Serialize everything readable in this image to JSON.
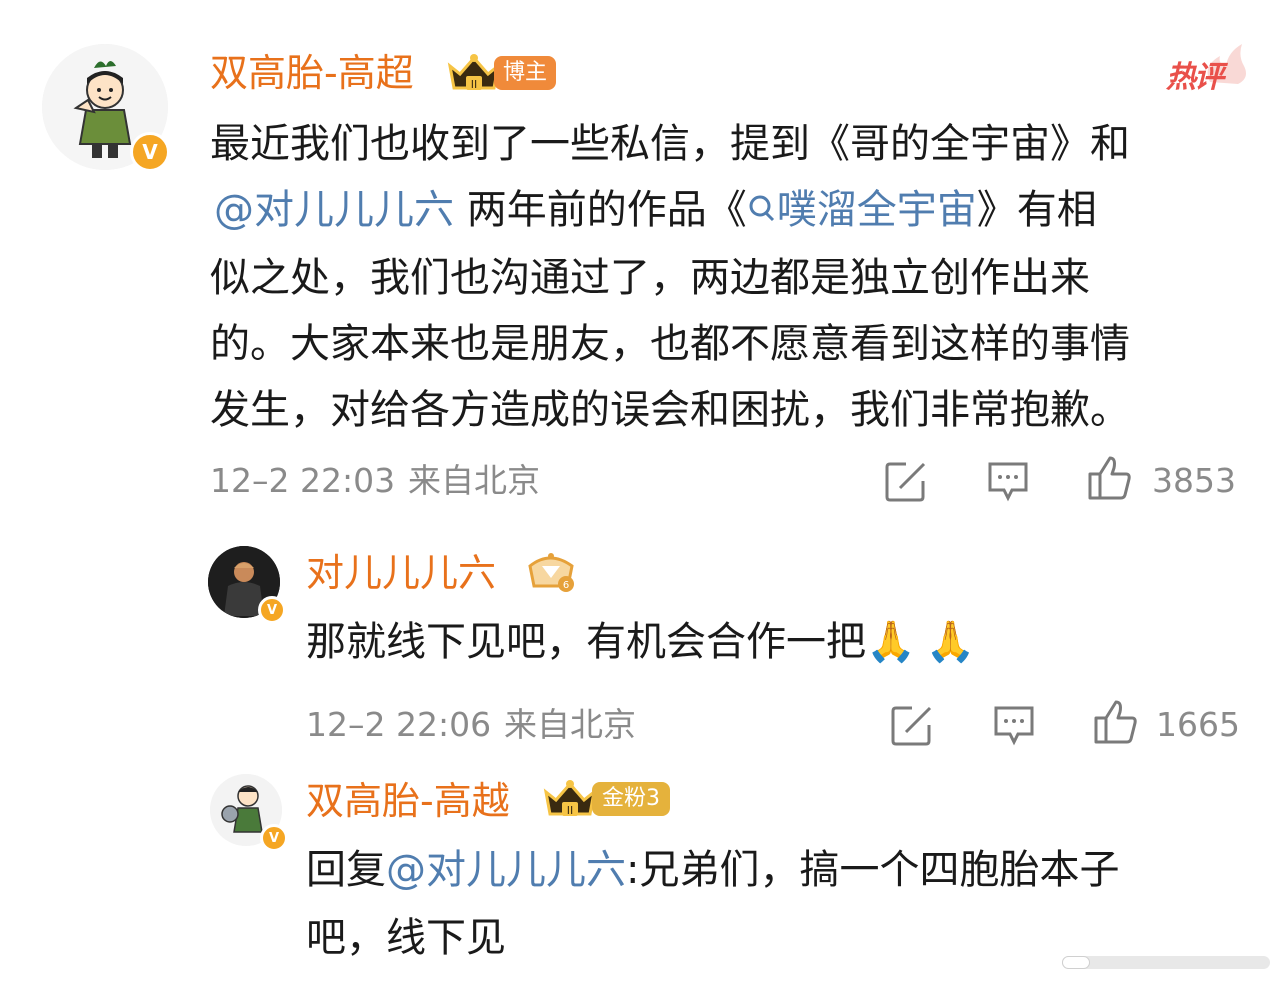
{
  "hot_tag": "热评",
  "comment": {
    "username": "双高胎-高超",
    "badge": "博主",
    "verified": "V",
    "lines": {
      "l1": "最近我们也收到了一些私信，提到《哥的全宇宙》和",
      "l2_mention": "@对儿儿儿六",
      "l2_rest_a": " 两年前的作品《",
      "l2_search_text": "噗溜全宇宙",
      "l2_rest_b": "》有相",
      "l3": "似之处，我们也沟通过了，两边都是独立创作出来",
      "l4": "的。大家本来也是朋友，也都不愿意看到这样的事情",
      "l5": "发生，对给各方造成的误会和困扰，我们非常抱歉。"
    },
    "time": "12–2 22:03",
    "location": "来自北京",
    "likes": "3853"
  },
  "reply1": {
    "username": "对儿儿儿六",
    "text": "那就线下见吧，有机会合作一把",
    "emoji": "🙏🙏",
    "time": "12–2 22:06",
    "location": "来自北京",
    "likes": "1665"
  },
  "reply2": {
    "username": "双高胎-高越",
    "badge": "金粉3",
    "prefix": "回复",
    "mention": "@对儿儿儿六",
    "text_a": ":兄弟们，搞一个四胞胎本子",
    "text_b": "吧，线下见"
  },
  "icons": {
    "share": "share-icon",
    "comment": "comment-icon",
    "like": "like-icon",
    "search": "search-icon",
    "crown": "crown-icon",
    "verified": "verified-icon"
  },
  "colors": {
    "username": "#e8711b",
    "mention": "#507daf",
    "meta": "#8a8a8a",
    "hot": "#e9504a"
  }
}
